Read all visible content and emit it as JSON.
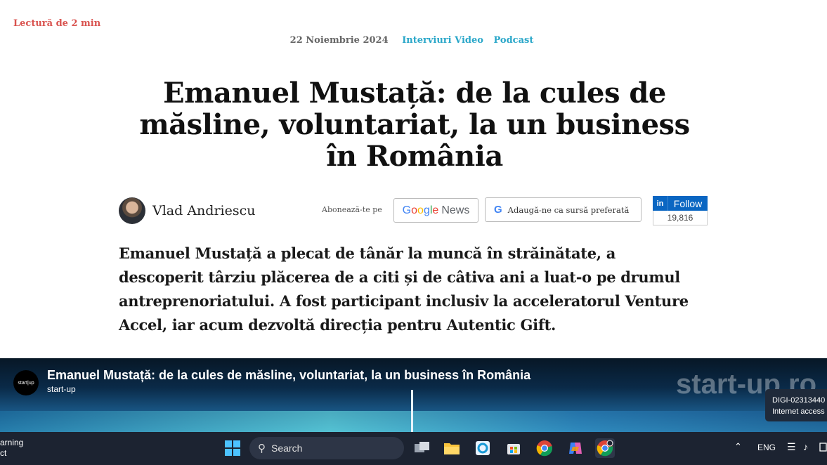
{
  "article": {
    "reading_time": "Lectură de 2 min",
    "date": "22 Noiembrie 2024",
    "categories": [
      "Interviuri Video",
      "Podcast"
    ],
    "title": "Emanuel Mustață: de la cules de măsline, voluntariat, la un business în România",
    "author": "Vlad Andriescu",
    "subscribe_label": "Abonează-te pe",
    "google_news": {
      "google": "Google",
      "news": "News"
    },
    "preferred_source_label": "Adaugă-ne ca sursă preferată",
    "linkedin": {
      "in": "in",
      "follow": "Follow",
      "count": "19,816"
    },
    "lead": "Emanuel Mustață a plecat de tânăr la muncă în străinătate, a descoperit târziu plăcerea de a citi și de câtiva ani a luat-o pe drumul antreprenoriatului. A fost participant inclusiv la acceleratorul Venture Accel, iar acum dezvoltă direcția pentru Autentic Gift."
  },
  "video": {
    "title": "Emanuel Mustață: de la cules de măsline, voluntariat, la un business în România",
    "channel": "start-up",
    "channel_logo": "start|up",
    "watermark": "start-up.ro"
  },
  "wifi_tooltip": {
    "network": "DIGI-02313440",
    "status": "Internet access"
  },
  "taskbar": {
    "left_line1": "arning",
    "left_line2": "ct",
    "search_placeholder": "Search",
    "language": "ENG",
    "icons": [
      "windows-start-icon",
      "search-icon",
      "task-view-icon",
      "file-explorer-icon",
      "snipping-tool-icon",
      "microsoft-store-icon",
      "chrome-icon",
      "copilot-icon",
      "chrome-profile-icon"
    ]
  },
  "colors": {
    "accent_red": "#d9534f",
    "category_blue": "#2aa7c9",
    "linkedin_blue": "#0a66c2",
    "taskbar_bg": "#1c2331"
  }
}
